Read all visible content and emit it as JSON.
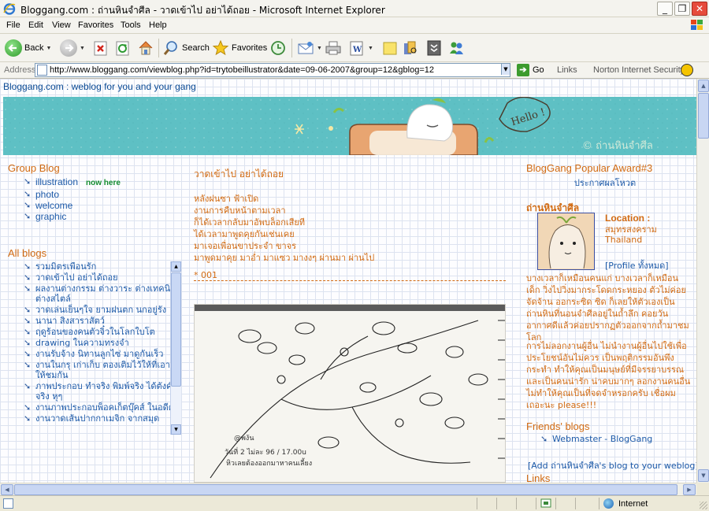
{
  "window": {
    "title": "Bloggang.com : ถ่านหินจำศีล - วาดเข้าไป อย่าได้ถอย - Microsoft Internet Explorer",
    "buttons": [
      "_",
      "❐",
      "✕"
    ]
  },
  "menu": [
    "File",
    "Edit",
    "View",
    "Favorites",
    "Tools",
    "Help"
  ],
  "toolbar": {
    "back_label": "Back",
    "search_label": "Search",
    "favorites_label": "Favorites"
  },
  "address": {
    "label": "Address",
    "url": "http://www.bloggang.com/viewblog.php?id=trytobeillustrator&date=09-06-2007&group=12&gblog=12",
    "go_label": "Go",
    "links_label": "Links",
    "norton_label": "Norton Internet Security"
  },
  "page": {
    "tagline": "Bloggang.com : weblog for you and your gang",
    "banner": {
      "bubble_text": "Hello !",
      "signature": "© ถ่านหินจำศีล"
    },
    "group_blog": {
      "title": "Group Blog",
      "items": [
        "illustration",
        "photo",
        "welcome",
        "graphic"
      ],
      "now_here": "now here"
    },
    "all_blogs": {
      "title": "All blogs",
      "items": [
        "รวมมิตรเพื่อนรัก",
        "วาดเข้าไป อย่าได้ถอย",
        "ผลงานต่างกรรม ต่างวาระ ต่างเทคนิค ต่างสไตล์",
        "วาดเล่นเย็นๆใจ ยามฝนตก นกอยู่รัง",
        "นานา สิงสาราสัตว์",
        "ฤดูร้อนของคนตัวจิ๋วในโลกใบโต",
        "drawing ในความทรงจำ",
        "งานรับจ้าง นิทานลูกไซ่ มาดูกันเร็ว",
        "งานในกรุ เก่าเก็บ ตองเติมไว้ให้ที่เอามาให้ชมกัน",
        "ภาพประกอบ ทำจริง พิมพ์จริง ได้ตังค์จริง หุๆ",
        "งานภาพประกอบพ็อคเก็ตบุ๊คส์ ในอดีต",
        "งานวาดเส้นปากกาเมจิก จากสมุด"
      ]
    },
    "post": {
      "title": "วาดเข้าไป อย่าได้ถอย",
      "lines": [
        "หลังฝนซา ฟ้าเปิด",
        "งานการคืบหน้าตามเวลา",
        "ก็ได้เวลากลับมาอัพบล็อกเสียที",
        "ได้เวลามาพูดคุยกันเช่นเคย",
        "มาเจอเพื่อนขาประจำ ขาจร",
        "มาพูดมาคุย มาอ่ำ มาแซว มางงๆ ผ่านมา ผ่านไป"
      ],
      "number": "* 001"
    },
    "award": {
      "title": "BlogGang Popular Award#3",
      "subtitle": "ประกาศผลโหวต"
    },
    "owner": {
      "title": "ถ่านหินจำศีล",
      "location_label": "Location :",
      "location_line1": "สมุทรสงคราม",
      "location_line2": "Thailand",
      "profile_link": "[Profile ทั้งหมด]",
      "bio_para1": "บางเวลาก็เหมือนคนแก่ บางเวลาก็เหมือนเด็ก วิ่งไปวิ่งมากระโดดกระหยอง ตัวไม่ค่อยจัดจ้าน ออกระซิด ซิด ก็เลยให้ตัวเองเป็นถ่านหินที่นอนจำศีลอยู่ในถ้ำลึก คอยวันอากาศดีแล้วค่อยปรากฏตัวออกจากถ้ำมาชมโลก",
      "bio_para2": "การไม่ลอกงานผู้อื่น ไม่นำงานผู้อื่นไปใช้เพื่อประโยชน์อันไม่ควร เป็นพฤติกรรมอันพึงกระทำ ทำให้คุณเป็นมนุษย์ที่มีจรรยาบรรณ และเป็นคนน่ารัก น่าคบมากๆ ลอกงานคนอื่นไม่ทำให้คุณเป็นที่จดจำหรอกครับ เชื่อผมเถอะนะ please!!!"
    },
    "friends": {
      "title": "Friends' blogs",
      "items": [
        "Webmaster - BlogGang"
      ],
      "add_link": "[Add ถ่านหินจำศีล's blog to your weblog]"
    },
    "links_title": "Links"
  },
  "status": {
    "zone": "Internet"
  }
}
